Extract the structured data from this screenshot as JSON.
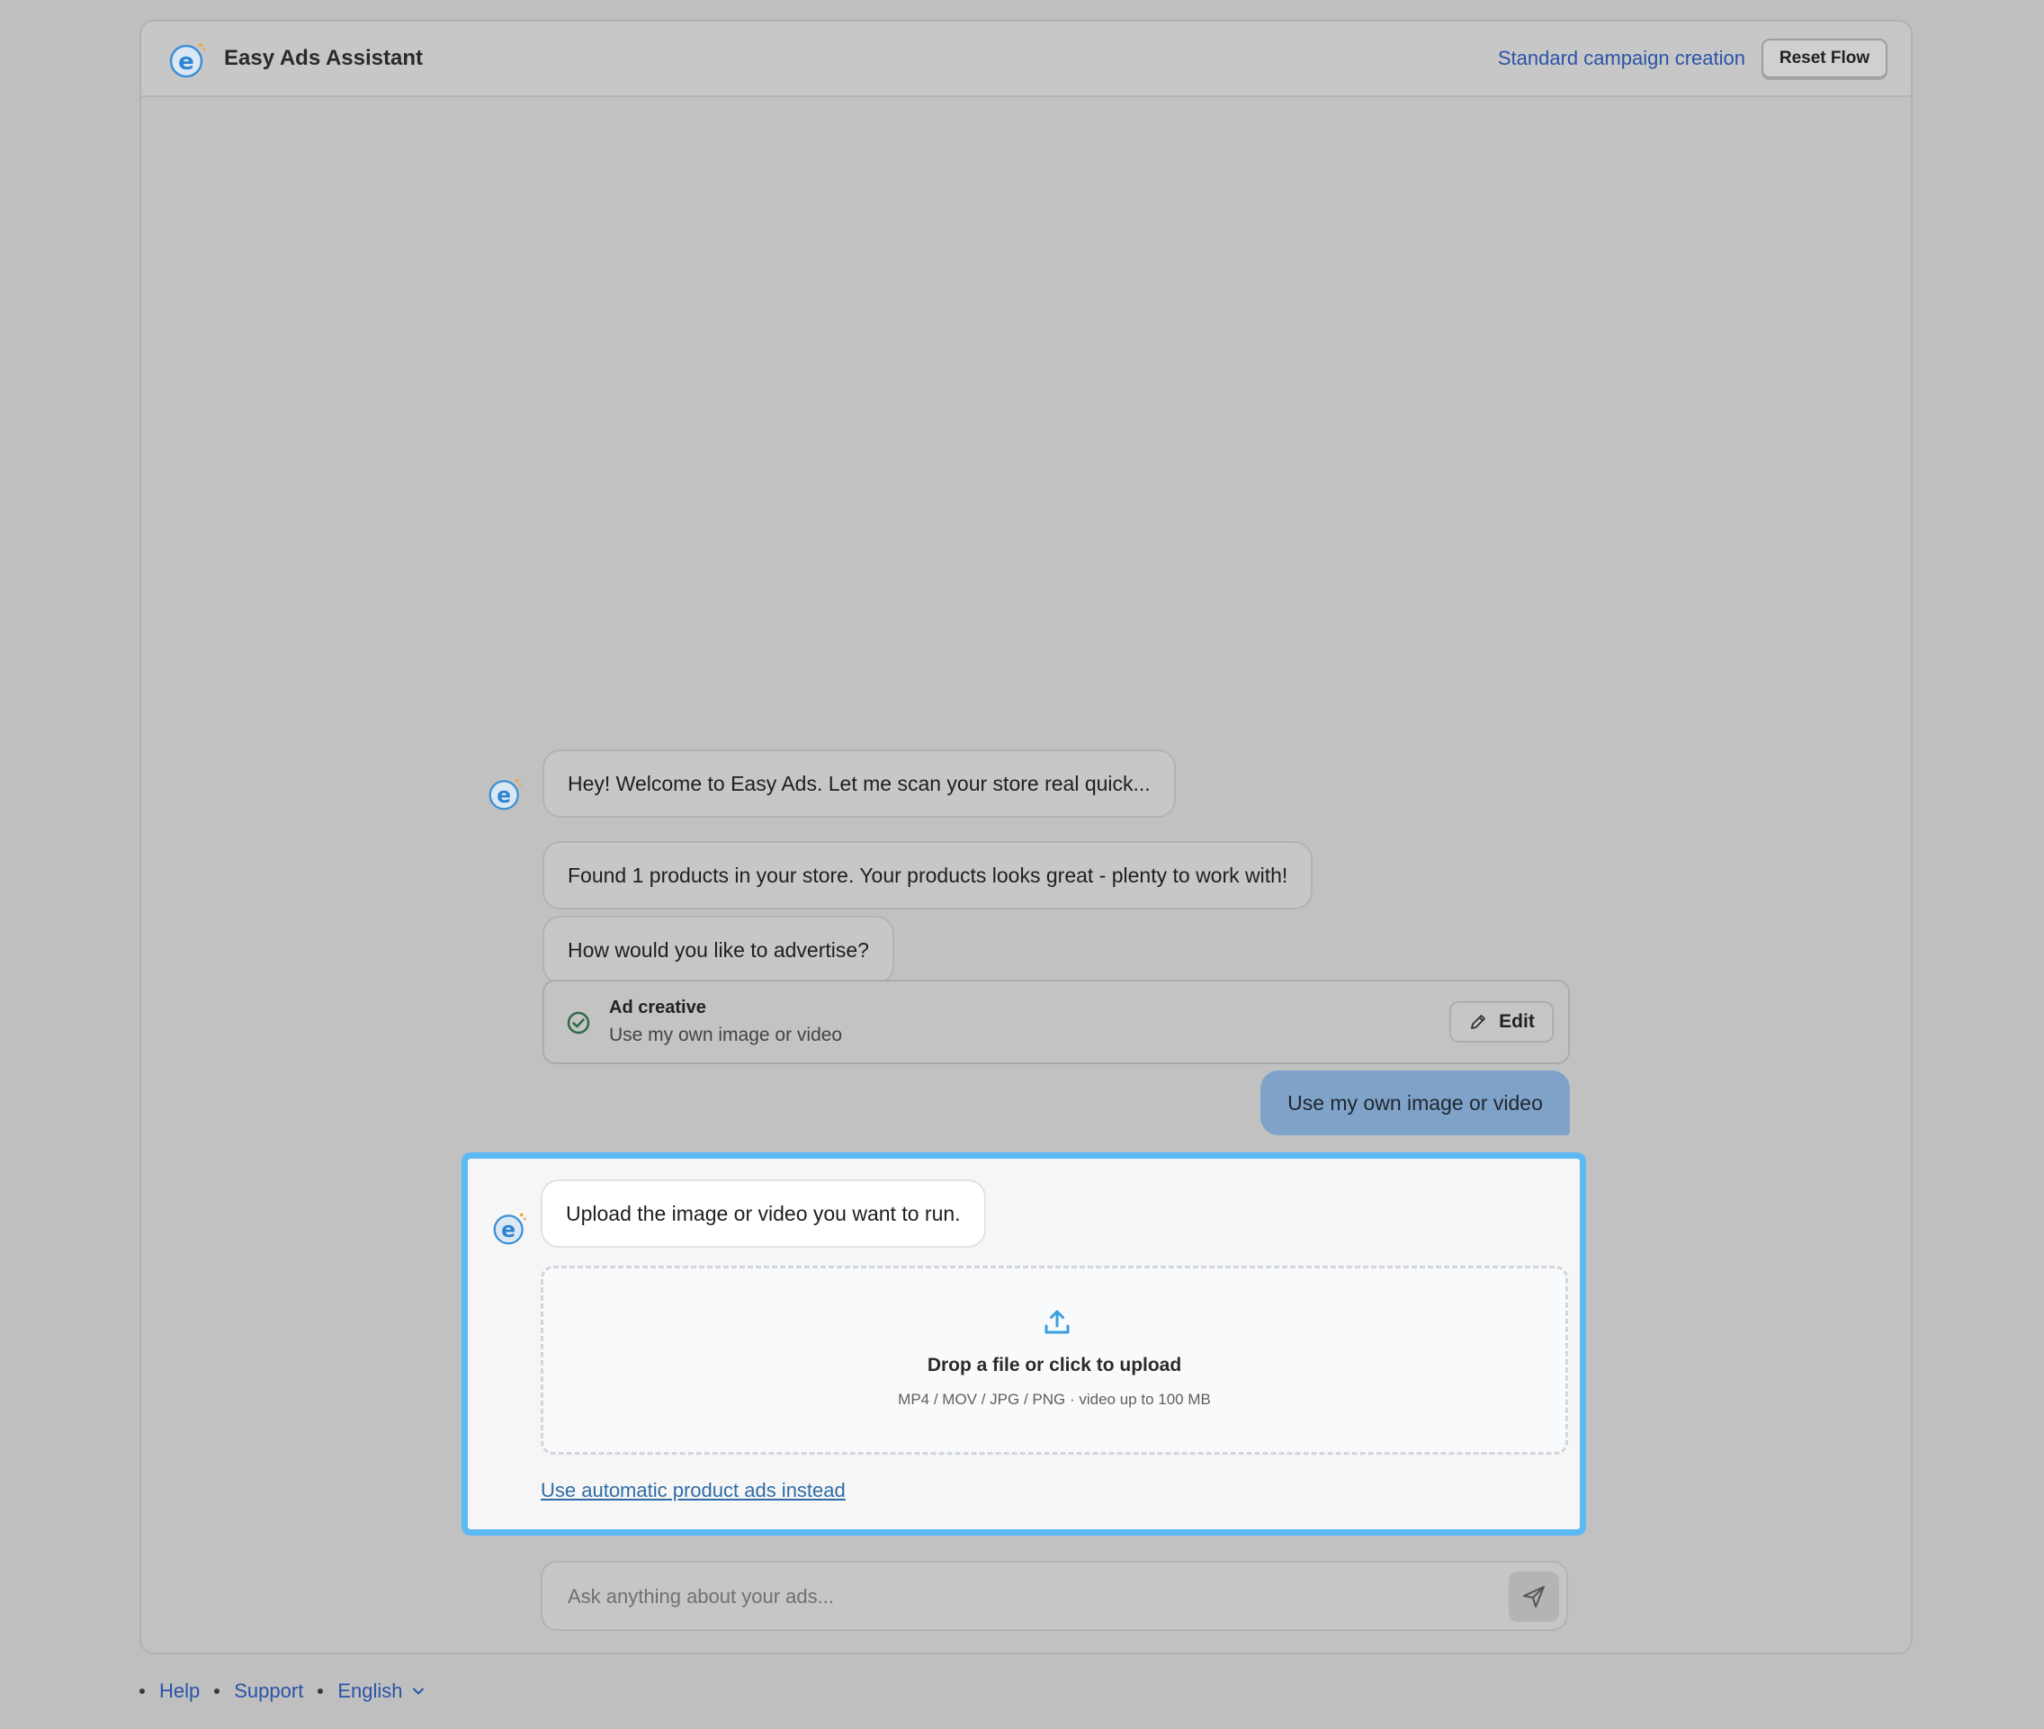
{
  "header": {
    "title": "Easy Ads Assistant",
    "link_label": "Standard campaign creation",
    "reset_label": "Reset Flow"
  },
  "chat": {
    "messages": [
      "Hey! Welcome to Easy Ads. Let me scan your store real quick...",
      "Found 1 products in your store. Your products looks great - plenty to work with!",
      "How would you like to advertise?"
    ],
    "card": {
      "title": "Ad creative",
      "value": "Use my own image or video",
      "edit_label": "Edit"
    },
    "user_reply": "Use my own image or video",
    "upload_prompt": "Upload the image or video you want to run.",
    "dropzone": {
      "title": "Drop a file or click to upload",
      "subtitle": "MP4 / MOV / JPG / PNG · video up to 100 MB"
    },
    "alt_link": "Use automatic product ads instead"
  },
  "composer": {
    "placeholder": "Ask anything about your ads..."
  },
  "footer": {
    "help": "Help",
    "support": "Support",
    "language": "English"
  },
  "colors": {
    "accent": "#5bb9f4",
    "link": "#2b53a8",
    "user_bubble": "#7fa3c8"
  }
}
